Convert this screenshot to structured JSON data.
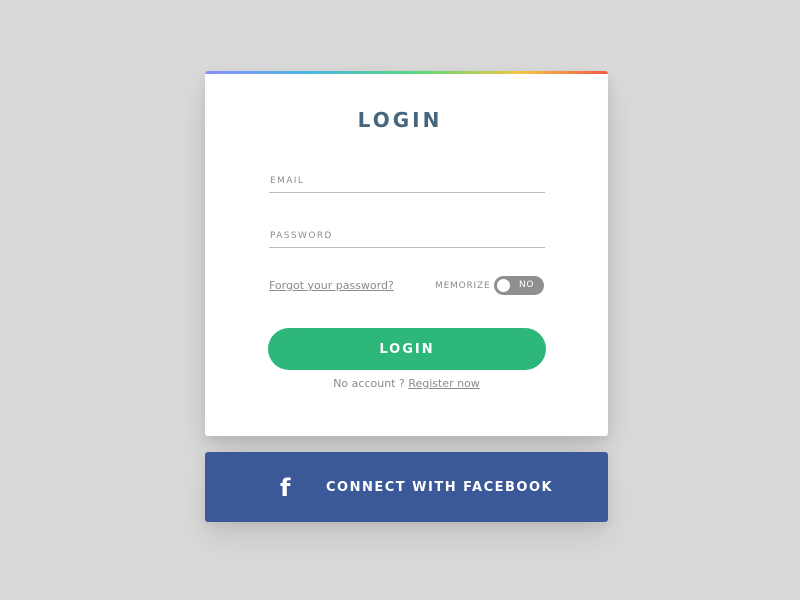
{
  "login_card": {
    "title": "LOGIN",
    "email": {
      "label": "EMAIL",
      "value": "",
      "placeholder": ""
    },
    "password": {
      "label": "PASSWORD",
      "value": "",
      "placeholder": ""
    },
    "forgot_password_link": "Forgot your password?",
    "memorize": {
      "label": "MEMORIZE",
      "toggle_state": "NO"
    },
    "login_button": "LOGIN",
    "register": {
      "prefix": "No account ? ",
      "link": "Register now"
    }
  },
  "facebook_button": {
    "icon": "facebook-icon",
    "label": "CONNECT WITH FACEBOOK"
  },
  "colors": {
    "background": "#d9dad9",
    "card": "#ffffff",
    "title": "#45667d",
    "login_button": "#2db77a",
    "facebook_button": "#3b5998",
    "toggle": "#8f8f8f",
    "secondary_text": "#8b8b8b"
  }
}
